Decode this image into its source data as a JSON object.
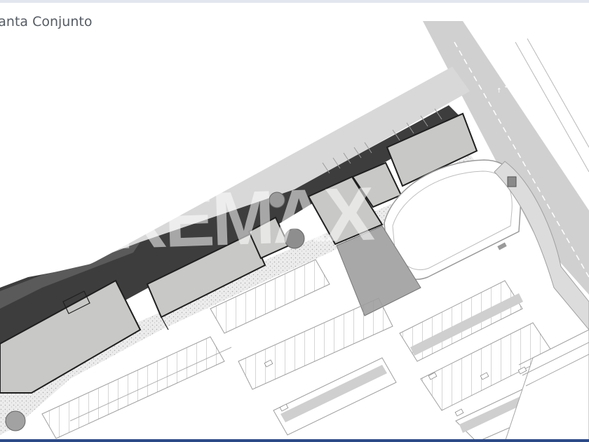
{
  "page": {
    "title": "lanta Conjunto",
    "watermark": "REMAX"
  },
  "colors": {
    "accent_bar": "#2c4a86",
    "road": "#d0d0d0",
    "building_fill": "#c8c9c6",
    "building_outline": "#1f1f1f",
    "shadow": "#4a4a4a",
    "gravel": "#e7e7e7",
    "parking_strip": "#cfcfcf"
  }
}
